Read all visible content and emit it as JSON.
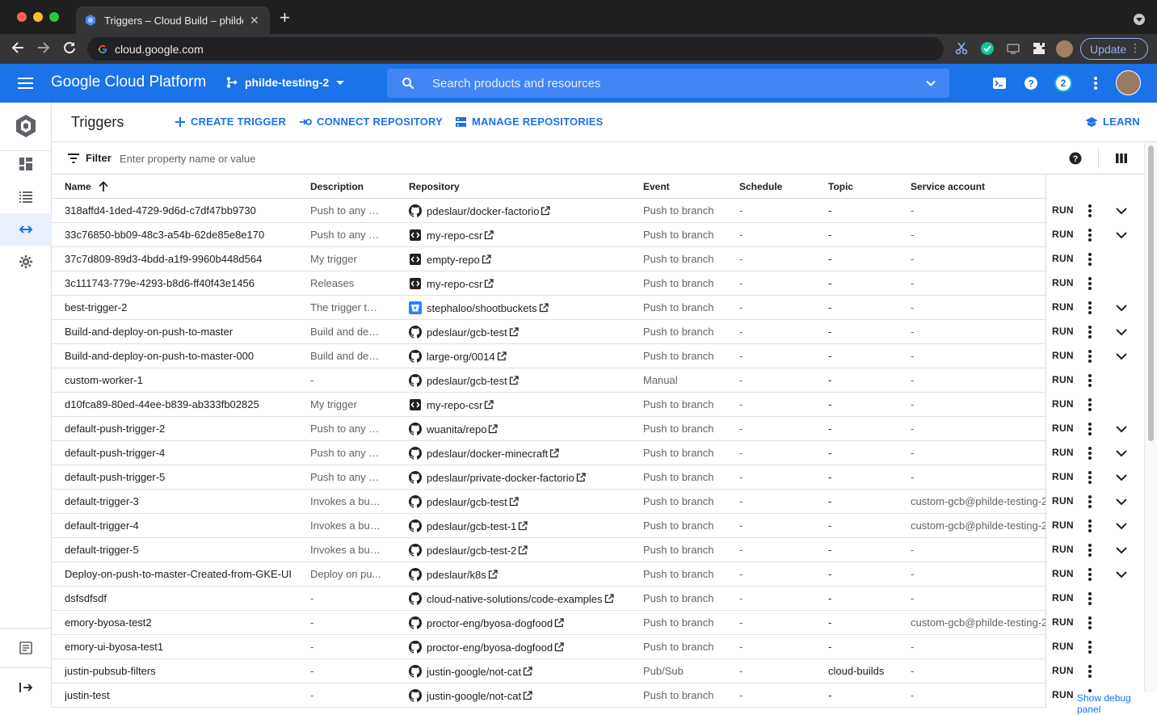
{
  "browser": {
    "tab_title": "Triggers – Cloud Build – philde",
    "url": "cloud.google.com",
    "update_label": "Update"
  },
  "gcp": {
    "brand": "Google Cloud Platform",
    "project": "philde-testing-2",
    "search_placeholder": "Search products and resources",
    "notifications_count": "2",
    "accent_color": "#1a73e8"
  },
  "page": {
    "title": "Triggers",
    "actions": {
      "create": "CREATE TRIGGER",
      "connect": "CONNECT REPOSITORY",
      "manage": "MANAGE REPOSITORIES",
      "learn": "LEARN"
    }
  },
  "filter": {
    "label": "Filter",
    "placeholder": "Enter property name or value"
  },
  "table": {
    "columns": {
      "name": "Name",
      "description": "Description",
      "repository": "Repository",
      "event": "Event",
      "schedule": "Schedule",
      "topic": "Topic",
      "service_account": "Service account"
    },
    "run_label": "RUN",
    "rows": [
      {
        "name": "318affd4-1ded-4729-9d6d-c7df47bb9730",
        "description": "Push to any b...",
        "repo_type": "github",
        "repository": "pdeslaur/docker-factorio",
        "event": "Push to branch",
        "schedule": "-",
        "topic": "-",
        "service_account": "-",
        "expandable": true
      },
      {
        "name": "33c76850-bb09-48c3-a54b-62de85e8e170",
        "description": "Push to any b...",
        "repo_type": "csr",
        "repository": "my-repo-csr",
        "event": "Push to branch",
        "schedule": "-",
        "topic": "-",
        "service_account": "-",
        "expandable": true
      },
      {
        "name": "37c7d809-89d3-4bdd-a1f9-9960b448d564",
        "description": "My trigger",
        "repo_type": "csr",
        "repository": "empty-repo",
        "event": "Push to branch",
        "schedule": "-",
        "topic": "-",
        "service_account": "-",
        "expandable": false
      },
      {
        "name": "3c111743-779e-4293-b8d6-ff40f43e1456",
        "description": "Releases",
        "repo_type": "csr",
        "repository": "my-repo-csr",
        "event": "Push to branch",
        "schedule": "-",
        "topic": "-",
        "service_account": "-",
        "expandable": false
      },
      {
        "name": "best-trigger-2",
        "description": "The trigger th...",
        "repo_type": "bitbucket",
        "repository": "stephaloo/shootbuckets",
        "event": "Push to branch",
        "schedule": "-",
        "topic": "-",
        "service_account": "-",
        "expandable": true
      },
      {
        "name": "Build-and-deploy-on-push-to-master",
        "description": "Build and dep...",
        "repo_type": "github",
        "repository": "pdeslaur/gcb-test",
        "event": "Push to branch",
        "schedule": "-",
        "topic": "-",
        "service_account": "-",
        "expandable": true
      },
      {
        "name": "Build-and-deploy-on-push-to-master-000",
        "description": "Build and dep...",
        "repo_type": "github",
        "repository": "large-org/0014",
        "event": "Push to branch",
        "schedule": "-",
        "topic": "-",
        "service_account": "-",
        "expandable": true
      },
      {
        "name": "custom-worker-1",
        "description": "-",
        "repo_type": "github",
        "repository": "pdeslaur/gcb-test",
        "event": "Manual",
        "schedule": "-",
        "topic": "-",
        "service_account": "-",
        "expandable": false
      },
      {
        "name": "d10fca89-80ed-44ee-b839-ab333fb02825",
        "description": "My trigger",
        "repo_type": "csr",
        "repository": "my-repo-csr",
        "event": "Push to branch",
        "schedule": "-",
        "topic": "-",
        "service_account": "-",
        "expandable": false
      },
      {
        "name": "default-push-trigger-2",
        "description": "Push to any b...",
        "repo_type": "github",
        "repository": "wuanita/repo",
        "event": "Push to branch",
        "schedule": "-",
        "topic": "-",
        "service_account": "-",
        "expandable": true
      },
      {
        "name": "default-push-trigger-4",
        "description": "Push to any b...",
        "repo_type": "github",
        "repository": "pdeslaur/docker-minecraft",
        "event": "Push to branch",
        "schedule": "-",
        "topic": "-",
        "service_account": "-",
        "expandable": true
      },
      {
        "name": "default-push-trigger-5",
        "description": "Push to any b...",
        "repo_type": "github",
        "repository": "pdeslaur/private-docker-factorio",
        "event": "Push to branch",
        "schedule": "-",
        "topic": "-",
        "service_account": "-",
        "expandable": true
      },
      {
        "name": "default-trigger-3",
        "description": "Invokes a buil...",
        "repo_type": "github",
        "repository": "pdeslaur/gcb-test",
        "event": "Push to branch",
        "schedule": "-",
        "topic": "-",
        "service_account": "custom-gcb@philde-testing-2",
        "expandable": true
      },
      {
        "name": "default-trigger-4",
        "description": "Invokes a buil...",
        "repo_type": "github",
        "repository": "pdeslaur/gcb-test-1",
        "event": "Push to branch",
        "schedule": "-",
        "topic": "-",
        "service_account": "custom-gcb@philde-testing-2",
        "expandable": true
      },
      {
        "name": "default-trigger-5",
        "description": "Invokes a buil...",
        "repo_type": "github",
        "repository": "pdeslaur/gcb-test-2",
        "event": "Push to branch",
        "schedule": "-",
        "topic": "-",
        "service_account": "-",
        "expandable": true
      },
      {
        "name": "Deploy-on-push-to-master-Created-from-GKE-UI",
        "description": "Deploy on pu...",
        "repo_type": "github",
        "repository": "pdeslaur/k8s",
        "event": "Push to branch",
        "schedule": "-",
        "topic": "-",
        "service_account": "-",
        "expandable": true
      },
      {
        "name": "dsfsdfsdf",
        "description": "-",
        "repo_type": "github",
        "repository": "cloud-native-solutions/code-examples",
        "event": "Push to branch",
        "schedule": "-",
        "topic": "-",
        "service_account": "-",
        "expandable": false
      },
      {
        "name": "emory-byosa-test2",
        "description": "-",
        "repo_type": "github",
        "repository": "proctor-eng/byosa-dogfood",
        "event": "Push to branch",
        "schedule": "-",
        "topic": "-",
        "service_account": "custom-gcb@philde-testing-2",
        "expandable": false
      },
      {
        "name": "emory-ui-byosa-test1",
        "description": "-",
        "repo_type": "github",
        "repository": "proctor-eng/byosa-dogfood",
        "event": "Push to branch",
        "schedule": "-",
        "topic": "-",
        "service_account": "-",
        "expandable": false
      },
      {
        "name": "justin-pubsub-filters",
        "description": "-",
        "repo_type": "github",
        "repository": "justin-google/not-cat",
        "event": "Pub/Sub",
        "schedule": "-",
        "topic": "cloud-builds",
        "service_account": "-",
        "expandable": false
      },
      {
        "name": "justin-test",
        "description": "-",
        "repo_type": "github",
        "repository": "justin-google/not-cat",
        "event": "Push to branch",
        "schedule": "-",
        "topic": "-",
        "service_account": "-",
        "expandable": false
      }
    ]
  },
  "footer": {
    "debug_link": "Show debug panel"
  }
}
